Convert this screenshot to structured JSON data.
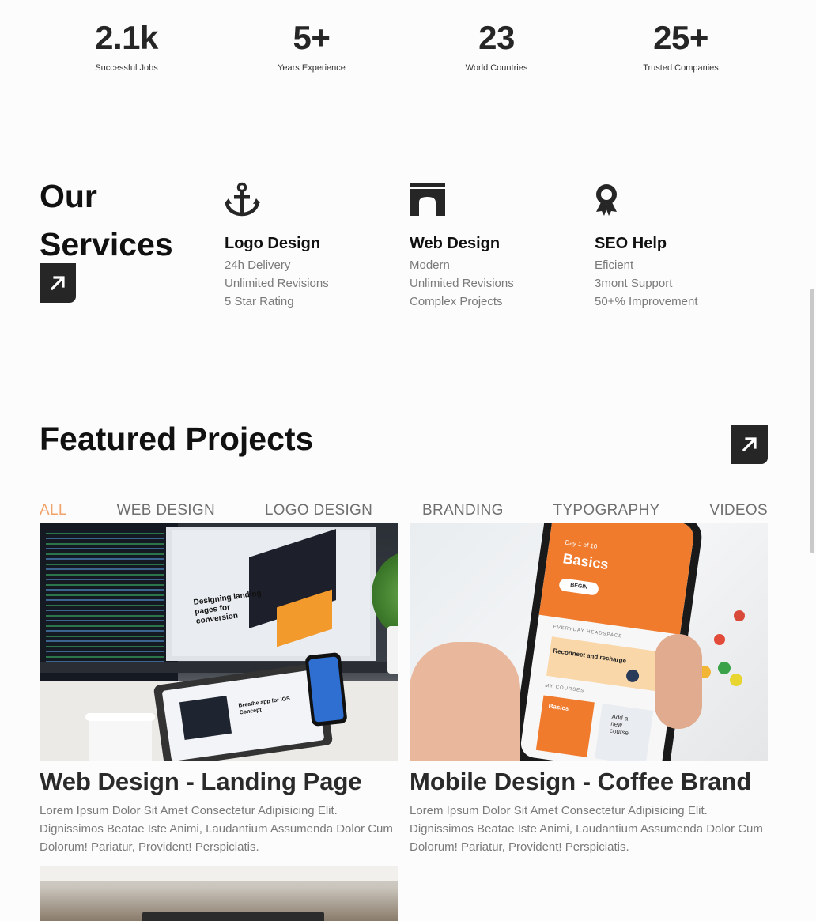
{
  "stats": [
    {
      "value": "2.1k",
      "label": "Successful Jobs"
    },
    {
      "value": "5+",
      "label": "Years Experience"
    },
    {
      "value": "23",
      "label": "World Countries"
    },
    {
      "value": "25+",
      "label": "Trusted Companies"
    }
  ],
  "services": {
    "title_line1": "Our",
    "title_line2": "Services",
    "items": [
      {
        "icon": "anchor-icon",
        "title": "Logo Design",
        "lines": [
          "24h Delivery",
          "Unlimited Revisions",
          "5 Star Rating"
        ]
      },
      {
        "icon": "archway-icon",
        "title": "Web Design",
        "lines": [
          "Modern",
          "Unlimited Revisions",
          "Complex Projects"
        ]
      },
      {
        "icon": "award-ribbon-icon",
        "title": "SEO Help",
        "lines": [
          "Eficient",
          "3mont Support",
          "50+% Improvement"
        ]
      }
    ]
  },
  "featured": {
    "title": "Featured Projects",
    "tabs": [
      "ALL",
      "WEB DESIGN",
      "LOGO DESIGN",
      "BRANDING",
      "TYPOGRAPHY",
      "VIDEOS"
    ],
    "active_tab": "ALL",
    "projects": [
      {
        "title": "Web Design - Landing Page",
        "description": "Lorem Ipsum Dolor Sit Amet Consectetur Adipisicing Elit. Dignissimos Beatae Iste Animi, Laudantium Assumenda Dolor Cum Dolorum! Pariatur, Provident! Perspiciatis.",
        "image_text": {
          "headline1": "Designing landing",
          "headline2": "pages for conversion",
          "tablet1": "Breathe app for iOS",
          "tablet2": "Concept"
        }
      },
      {
        "title": "Mobile Design - Coffee Brand",
        "description": "Lorem Ipsum Dolor Sit Amet Consectetur Adipisicing Elit. Dignissimos Beatae Iste Animi, Laudantium Assumenda Dolor Cum Dolorum! Pariatur, Provident! Perspiciatis.",
        "image_text": {
          "day": "Day 1 of 10",
          "basics": "Basics",
          "begin": "BEGIN",
          "everyday": "EVERYDAY HEADSPACE",
          "reconnect": "Reconnect and recharge",
          "courses": "MY COURSES",
          "card1": "Basics",
          "card2": "Add a new course"
        }
      }
    ]
  },
  "colors": {
    "accent": "#f0a36a",
    "dark": "#262626",
    "muted": "#7a7a7a",
    "orange": "#f07b2d"
  }
}
